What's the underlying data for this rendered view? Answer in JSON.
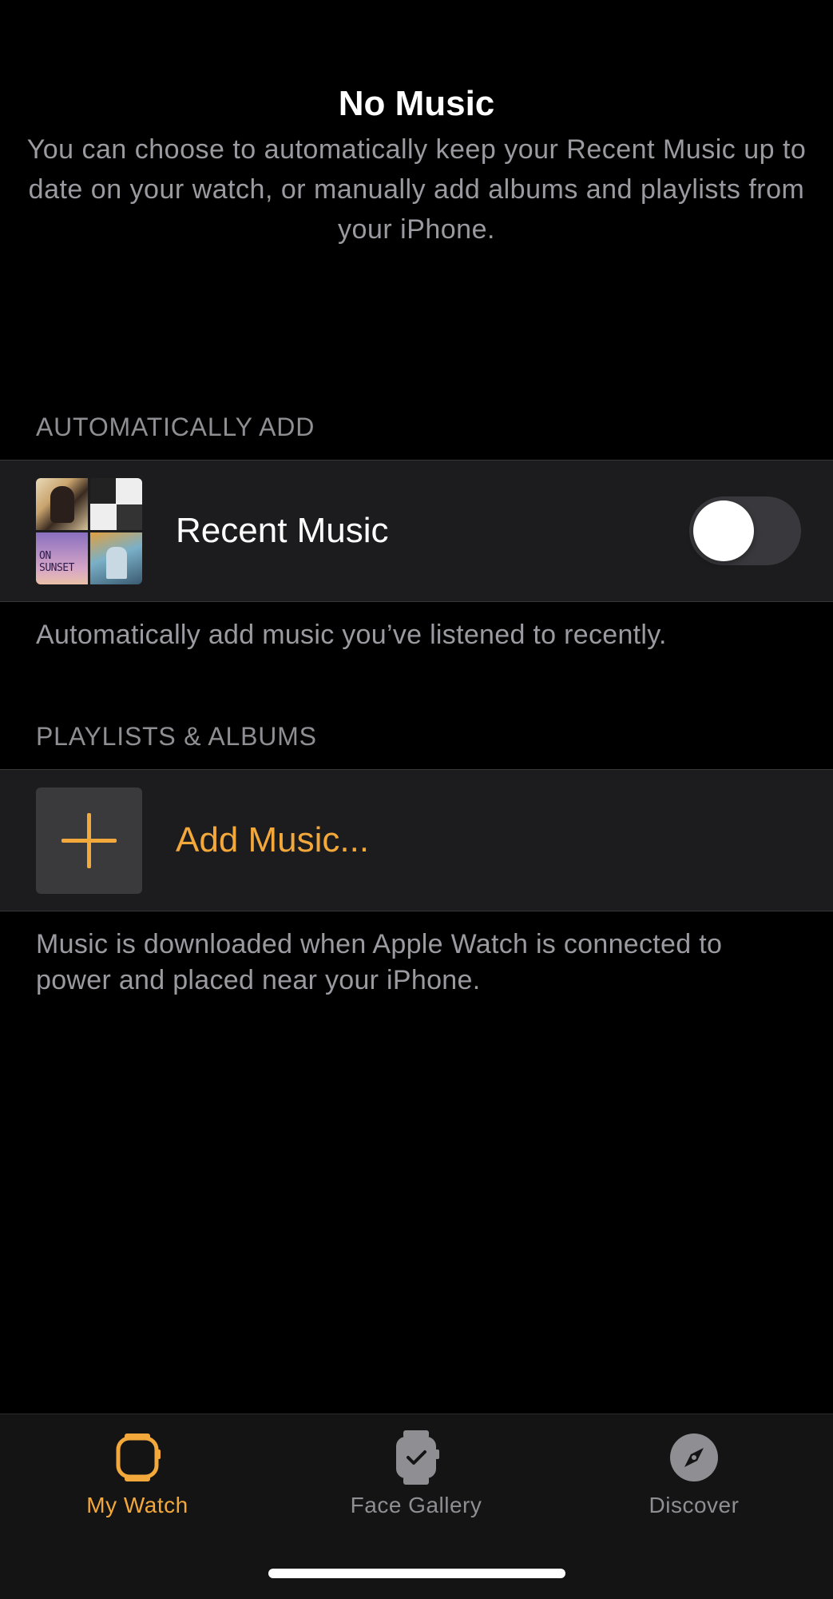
{
  "header": {
    "title": "No Music",
    "description": "You can choose to automatically keep your Recent Music up to date on your watch, or manually add albums and playlists from your iPhone."
  },
  "auto_add": {
    "section_label": "AUTOMATICALLY ADD",
    "recent_music_label": "Recent Music",
    "toggle_on": false,
    "artwork_text": "ON SUNSET",
    "footnote": "Automatically add music you’ve listened to recently."
  },
  "playlists": {
    "section_label": "PLAYLISTS & ALBUMS",
    "add_label": "Add Music...",
    "footnote": "Music is downloaded when Apple Watch is connected to power and placed near your iPhone."
  },
  "tabs": [
    {
      "label": "My Watch",
      "icon": "watch-icon",
      "active": true
    },
    {
      "label": "Face Gallery",
      "icon": "watch-face-icon",
      "active": false
    },
    {
      "label": "Discover",
      "icon": "compass-icon",
      "active": false
    }
  ],
  "colors": {
    "accent": "#f3a83b",
    "background": "#000000",
    "cell": "#1c1c1e",
    "secondary_text": "#9a9aa0"
  }
}
